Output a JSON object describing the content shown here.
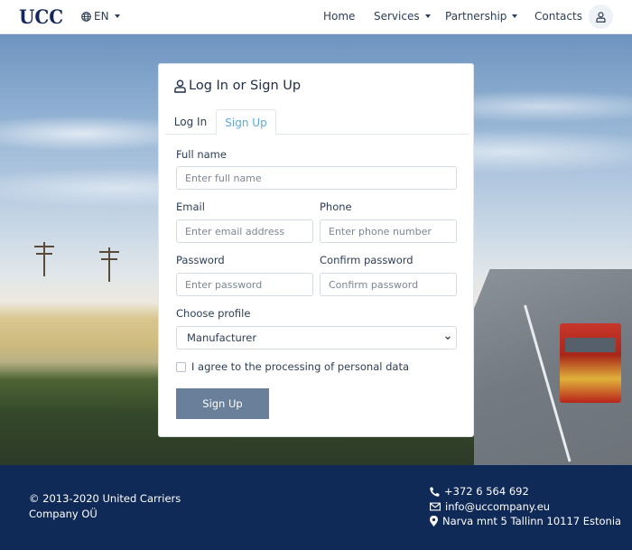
{
  "header": {
    "logo": "UCC",
    "language": "EN",
    "nav": {
      "home": "Home",
      "services": "Services",
      "partnership": "Partnership",
      "contacts": "Contacts"
    }
  },
  "auth_card": {
    "title": "Log In or Sign Up",
    "tabs": [
      {
        "label": "Log In",
        "active": false
      },
      {
        "label": "Sign Up",
        "active": true
      }
    ],
    "form": {
      "full_name": {
        "label": "Full name",
        "placeholder": "Enter full name",
        "value": ""
      },
      "email": {
        "label": "Email",
        "placeholder": "Enter email address",
        "value": ""
      },
      "phone": {
        "label": "Phone",
        "placeholder": "Enter phone number",
        "value": ""
      },
      "password": {
        "label": "Password",
        "placeholder": "Enter password",
        "value": ""
      },
      "confirm_password": {
        "label": "Confirm password",
        "placeholder": "Confirm password",
        "value": ""
      },
      "profile": {
        "label": "Choose profile",
        "selected": "Manufacturer"
      },
      "agree": {
        "label": "I agree to the processing of personal data",
        "checked": false
      },
      "submit_label": "Sign Up"
    }
  },
  "footer": {
    "copyright": "© 2013-2020 United Carriers Company OÜ",
    "phone": "+372 6 564 692",
    "email": "info@uccompany.eu",
    "address": "Narva mnt 5 Tallinn 10117 Estonia"
  },
  "colors": {
    "brand_navy": "#0f2a57",
    "active_tab": "#5aa9df",
    "button": "#6a7f99"
  }
}
